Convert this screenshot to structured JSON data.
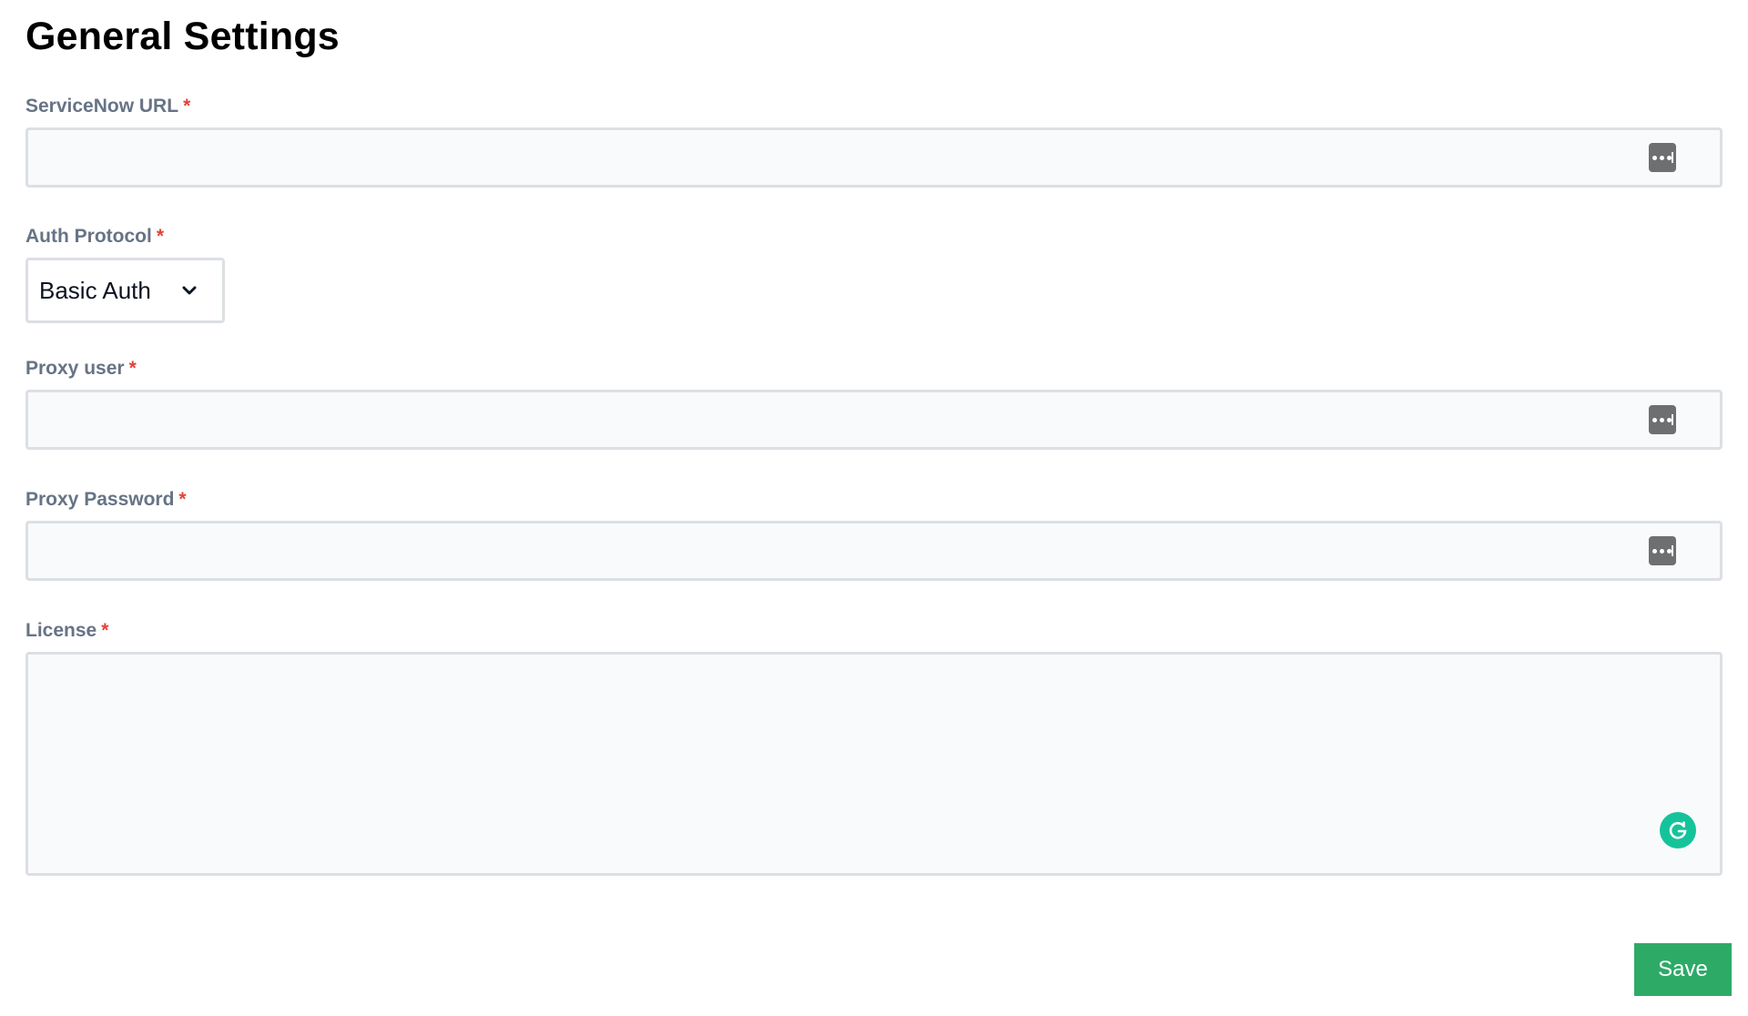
{
  "page": {
    "title": "General Settings"
  },
  "fields": {
    "servicenow_url": {
      "label": "ServiceNow URL",
      "required_mark": "*",
      "value": "",
      "icon": "password-manager-icon"
    },
    "auth_protocol": {
      "label": "Auth Protocol",
      "required_mark": "*",
      "selected": "Basic Auth",
      "icon": "chevron-down-icon"
    },
    "proxy_user": {
      "label": "Proxy user",
      "required_mark": "*",
      "value": "",
      "icon": "password-manager-icon"
    },
    "proxy_password": {
      "label": "Proxy Password",
      "required_mark": "*",
      "value": "",
      "icon": "password-manager-icon"
    },
    "license": {
      "label": "License",
      "required_mark": "*",
      "value": "",
      "icon": "grammarly-icon"
    }
  },
  "actions": {
    "save_label": "Save"
  },
  "colors": {
    "label": "#677385",
    "required": "#e0433a",
    "save_button": "#2eaa67",
    "grammarly": "#15c39a",
    "input_border": "#dcdfe3",
    "input_bg": "#f9fafb"
  }
}
